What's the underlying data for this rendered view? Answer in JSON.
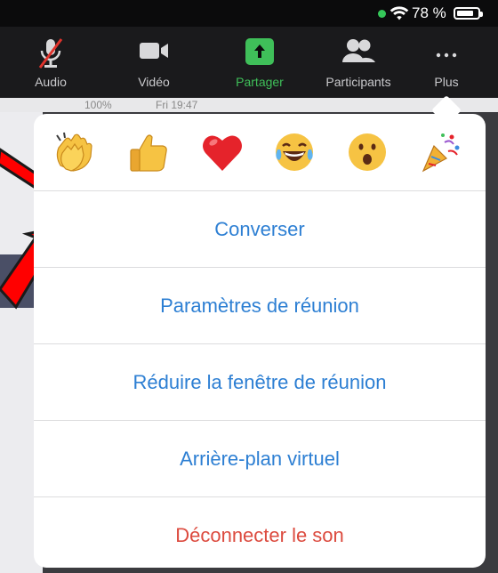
{
  "status": {
    "battery_pct": "78 %",
    "wifi": "wifi-icon"
  },
  "toolbar": {
    "items": [
      {
        "label": "Audio",
        "icon": "mic-muted-icon"
      },
      {
        "label": "Vidéo",
        "icon": "camera-icon"
      },
      {
        "label": "Partager",
        "icon": "share-icon"
      },
      {
        "label": "Participants",
        "icon": "participants-icon"
      },
      {
        "label": "Plus",
        "icon": "more-icon"
      }
    ],
    "share_color": "#3fbf59"
  },
  "background": {
    "menubar_battery": "100%",
    "menubar_time": "Fri 19:47"
  },
  "reactions": [
    {
      "name": "clapping-hands",
      "emoji": "👏"
    },
    {
      "name": "thumbs-up",
      "emoji": "👍"
    },
    {
      "name": "red-heart",
      "emoji": "❤️"
    },
    {
      "name": "tears-of-joy",
      "emoji": "😂"
    },
    {
      "name": "open-mouth",
      "emoji": "😮"
    },
    {
      "name": "party-popper",
      "emoji": "🎉"
    }
  ],
  "menu": {
    "items": [
      {
        "label": "Converser"
      },
      {
        "label": "Paramètres de réunion"
      },
      {
        "label": "Réduire la fenêtre de réunion"
      },
      {
        "label": "Arrière-plan virtuel"
      },
      {
        "label": "Déconnecter le son"
      }
    ],
    "link_color": "#2d7fd3",
    "danger_color": "#dc4b3f"
  }
}
